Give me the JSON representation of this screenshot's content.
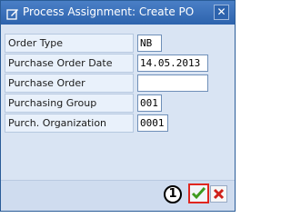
{
  "window": {
    "title": "Process Assignment: Create PO",
    "title_icon": "edit-doc-icon",
    "close_glyph": "✕"
  },
  "form": {
    "fields": [
      {
        "label": "Order Type",
        "value": "NB"
      },
      {
        "label": "Purchase Order Date",
        "value": "14.05.2013"
      },
      {
        "label": "Purchase Order",
        "value": ""
      },
      {
        "label": "Purchasing Group",
        "value": "001"
      },
      {
        "label": "Purch. Organization",
        "value": "0001"
      }
    ]
  },
  "footer": {
    "callout_number": "1",
    "confirm_icon": "checkmark-icon",
    "cancel_icon": "cancel-x-icon"
  },
  "colors": {
    "titlebar": "#2d63ad",
    "confirm": "#3e9a1f",
    "cancel": "#d0211a",
    "highlight": "#e0261f"
  }
}
